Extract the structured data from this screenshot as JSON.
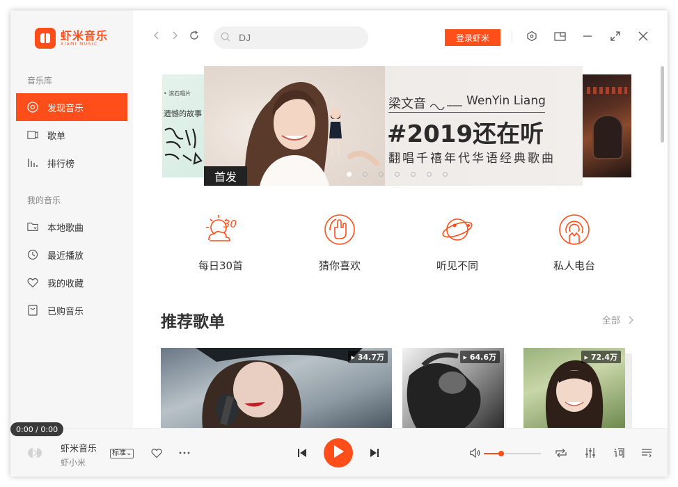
{
  "app": {
    "brand_cn": "虾米音乐",
    "brand_en": "XIAMI MUSIC",
    "accent": "#ff4e1a"
  },
  "sidebar": {
    "section1": "音乐库",
    "section1_items": [
      {
        "label": "发现音乐",
        "icon": "discover-icon",
        "active": true
      },
      {
        "label": "歌单",
        "icon": "playlist-icon"
      },
      {
        "label": "排行榜",
        "icon": "chart-icon"
      }
    ],
    "section2": "我的音乐",
    "section2_items": [
      {
        "label": "本地歌曲",
        "icon": "folder-icon"
      },
      {
        "label": "最近播放",
        "icon": "clock-icon"
      },
      {
        "label": "我的收藏",
        "icon": "heart-icon"
      },
      {
        "label": "已购音乐",
        "icon": "purchased-icon"
      }
    ]
  },
  "header": {
    "search_placeholder": "DJ",
    "login_label": "登录虾米"
  },
  "banner": {
    "tag": "首发",
    "artist_cn": "梁文音",
    "artist_en": "WenYin Liang",
    "title": "#2019还在听",
    "subtitle": "翻唱千禧年代华语经典歌曲",
    "left_snippet": "遗憾的故事",
    "left_label": "• 滚石唱片",
    "dots": 7,
    "active_dot": 0
  },
  "features": [
    {
      "label": "每日30首",
      "icon": "daily-30-icon"
    },
    {
      "label": "猜你喜欢",
      "icon": "guess-like-icon"
    },
    {
      "label": "听见不同",
      "icon": "planet-icon"
    },
    {
      "label": "私人电台",
      "icon": "radio-icon"
    }
  ],
  "recommend": {
    "title": "推荐歌单",
    "all_label": "全部",
    "cards": [
      {
        "plays": "34.7万"
      },
      {
        "plays": "64.6万"
      },
      {
        "plays": "72.4万"
      }
    ]
  },
  "player": {
    "time": "0:00 / 0:00",
    "song": "虾米音乐",
    "artist": "虾小米",
    "quality": "标准",
    "volume_fraction": 0.3
  }
}
